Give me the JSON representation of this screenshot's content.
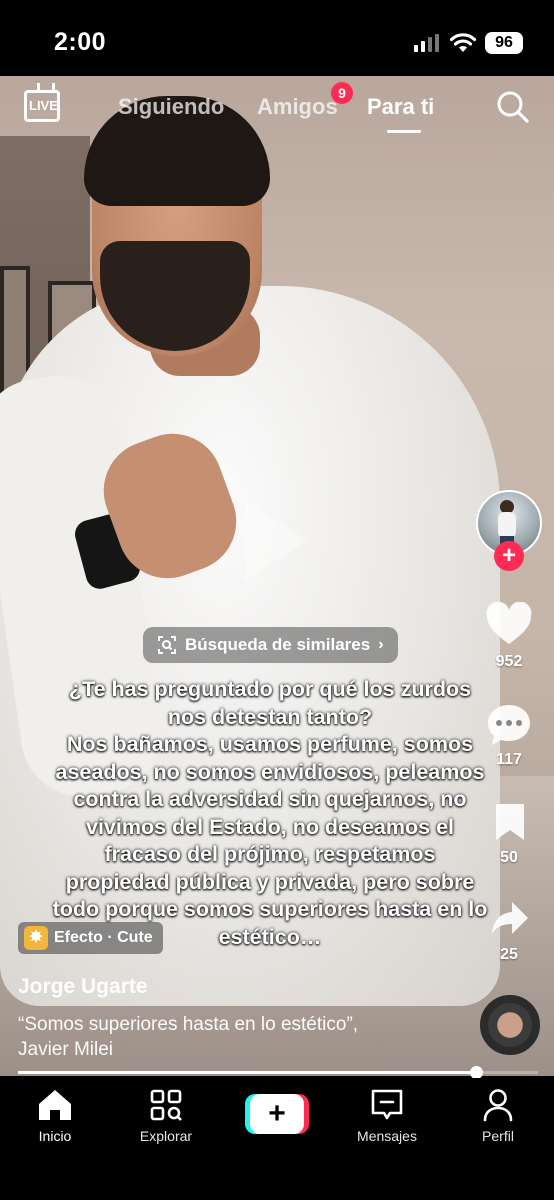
{
  "status_bar": {
    "time": "2:00",
    "battery": "96"
  },
  "top_nav": {
    "live_label": "LIVE",
    "tabs": [
      {
        "label": "Siguiendo",
        "active": false
      },
      {
        "label": "Amigos",
        "active": false,
        "badge": "9"
      },
      {
        "label": "Para ti",
        "active": true
      }
    ]
  },
  "rail": {
    "follow_plus": "+",
    "likes": "952",
    "comments": "117",
    "saves": "50",
    "shares": "25"
  },
  "similar_search": {
    "label": "Búsqueda de similares"
  },
  "caption_lines": [
    "¿Te has preguntado por qué los zurdos",
    "nos detestan tanto?",
    "Nos bañamos, usamos perfume, somos",
    "aseados, no somos envidiosos, peleamos",
    "contra la adversidad sin quejarnos, no",
    "vivimos del Estado, no deseamos el",
    "fracaso del prójimo, respetamos",
    "propiedad pública y privada, pero sobre",
    "todo porque somos superiores hasta en lo",
    "estético…"
  ],
  "effect": {
    "label": "Efecto · Cute"
  },
  "post": {
    "author": "Jorge Ugarte",
    "description": "“Somos superiores hasta en lo estético”, Javier Milei",
    "progress": 0.88
  },
  "bottom_nav": {
    "items": [
      {
        "label": "Inicio",
        "icon": "home-icon",
        "active": true
      },
      {
        "label": "Explorar",
        "icon": "explore-icon",
        "active": false
      },
      {
        "label": "+",
        "icon": "create-icon",
        "active": false
      },
      {
        "label": "Mensajes",
        "icon": "inbox-icon",
        "active": false
      },
      {
        "label": "Perfil",
        "icon": "profile-icon",
        "active": false
      }
    ]
  },
  "colors": {
    "accent": "#fe2c55",
    "cyan": "#25f4ee"
  }
}
